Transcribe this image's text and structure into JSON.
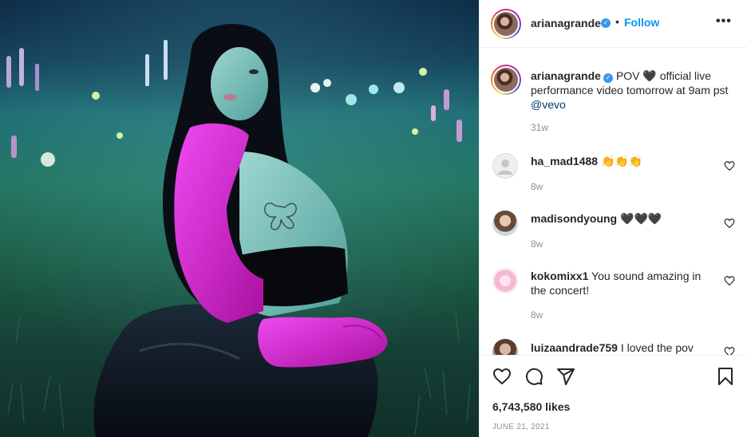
{
  "post": {
    "image_alt": "Woman in pink gloves crouching in a flower field at dusk",
    "author": {
      "username": "arianagrande",
      "verified_mark": "✓",
      "separator": "•",
      "follow_label": "Follow",
      "more_label": "•••"
    },
    "caption": {
      "username": "arianagrande",
      "text": "POV 🖤 official live performance video tomorrow at 9am pst",
      "mention": "@vevo",
      "time": "31w"
    },
    "comments": [
      {
        "username": "ha_mad1488",
        "text": "👏👏👏",
        "time": "8w"
      },
      {
        "username": "madisondyoung",
        "text": "🖤🖤🖤",
        "time": "8w"
      },
      {
        "username": "kokomixx1",
        "text": "You sound amazing in the concert!",
        "time": "8w"
      },
      {
        "username": "luizaandrade759",
        "text": "I loved the pov",
        "time": ""
      }
    ],
    "likes": "6,743,580 likes",
    "date": "JUNE 21, 2021"
  },
  "icons": {
    "like": "heart-icon",
    "comment": "comment-icon",
    "share": "share-icon",
    "save": "bookmark-icon",
    "more": "more-icon",
    "verified": "verified-badge-icon"
  },
  "colors": {
    "link": "#0095f6",
    "verified": "#3897f0",
    "meta_text": "#8e8e8e",
    "glove": "#d21fd6"
  }
}
